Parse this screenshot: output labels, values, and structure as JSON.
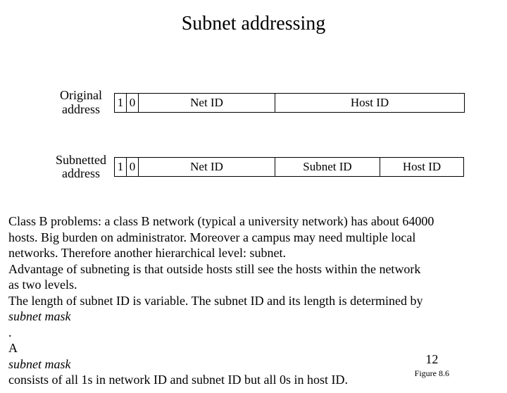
{
  "title": "Subnet addressing",
  "row1": {
    "label_l1": "Original",
    "label_l2": "address",
    "bit1": "1",
    "bit2": "0",
    "netid": "Net ID",
    "hostid": "Host ID"
  },
  "row2": {
    "label_l1": "Subnetted",
    "label_l2": "address",
    "bit1": "1",
    "bit2": "0",
    "netid": "Net ID",
    "subnetid": "Subnet ID",
    "hostid": "Host ID"
  },
  "body": {
    "l1": "Class B problems: a class B network (typical a university network) has about 64000",
    "l2": " hosts. Big burden on administrator. Moreover a campus may need multiple local",
    "l3": "networks. Therefore another hierarchical level: subnet.",
    "l4": "Advantage of subneting is that outside hosts still see the hosts within the network",
    "l5": "as two levels.",
    "l6": "The length of subnet ID is variable. The subnet ID and its length is determined by",
    "l7_pre": "",
    "l7_it": "subnet mask",
    "l7_post": ".",
    "l8_pre": "A ",
    "l8_it": "subnet mask",
    "l8_post": " consists of all 1s in network ID and subnet ID but all 0s in host ID."
  },
  "page_number": "12",
  "figure_ref": "Figure 8.6"
}
